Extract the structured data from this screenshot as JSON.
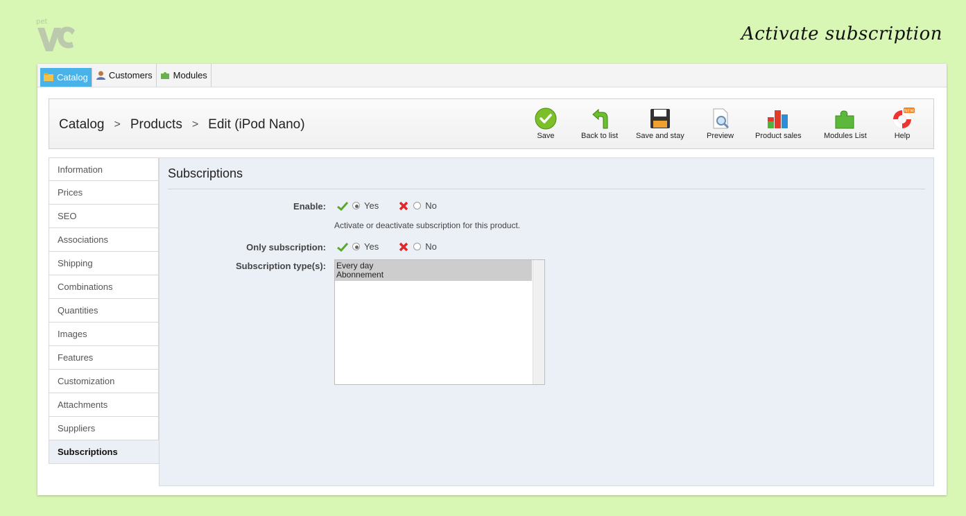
{
  "page": {
    "hero_title": "Activate subscription",
    "logo_text": "pet"
  },
  "topnav": [
    {
      "label": "Catalog",
      "icon": "folder-icon"
    },
    {
      "label": "Customers",
      "icon": "user-icon"
    },
    {
      "label": "Modules",
      "icon": "puzzle-icon"
    }
  ],
  "breadcrumb": {
    "level1": "Catalog",
    "level2": "Products",
    "level3": "Edit (iPod Nano)",
    "separator": ">"
  },
  "toolbar": {
    "save": "Save",
    "back": "Back to list",
    "save_stay": "Save and stay",
    "preview": "Preview",
    "product_sales": "Product sales",
    "modules_list": "Modules List",
    "help": "Help",
    "help_badge": "NEW"
  },
  "sidebar": {
    "items": [
      {
        "label": "Information"
      },
      {
        "label": "Prices"
      },
      {
        "label": "SEO"
      },
      {
        "label": "Associations"
      },
      {
        "label": "Shipping"
      },
      {
        "label": "Combinations"
      },
      {
        "label": "Quantities"
      },
      {
        "label": "Images"
      },
      {
        "label": "Features"
      },
      {
        "label": "Customization"
      },
      {
        "label": "Attachments"
      },
      {
        "label": "Suppliers"
      },
      {
        "label": "Subscriptions"
      }
    ],
    "active": "Subscriptions"
  },
  "content": {
    "title": "Subscriptions",
    "enable_label": "Enable:",
    "enable_yes": "Yes",
    "enable_no": "No",
    "enable_hint": "Activate or deactivate subscription for this product.",
    "only_label": "Only subscription:",
    "only_yes": "Yes",
    "only_no": "No",
    "types_label": "Subscription type(s):",
    "types_options": [
      "Every day",
      "Abonnement"
    ]
  },
  "colors": {
    "background": "#d9f7b4",
    "active_tab": "#49b2e8",
    "content_bg": "#ebeff6"
  }
}
